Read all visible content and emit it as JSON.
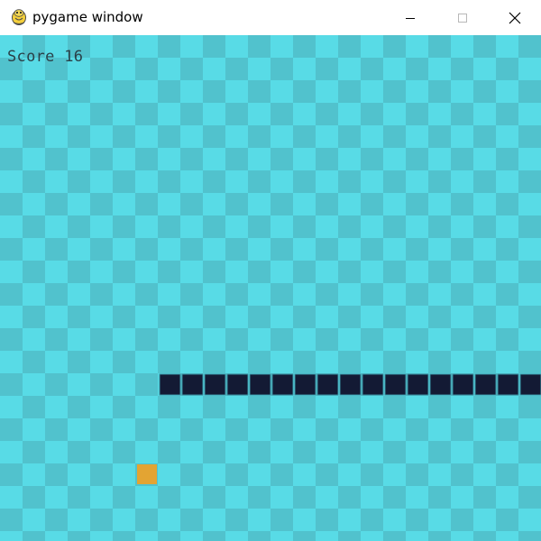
{
  "window": {
    "title": "pygame window",
    "icon": "pygame-snake-icon"
  },
  "controls": {
    "minimize_icon": "minimize-icon",
    "maximize_icon": "maximize-icon",
    "close_icon": "close-icon"
  },
  "game": {
    "score_text": "Score 16",
    "colors": {
      "checker_light": "#58dbe6",
      "checker_dark": "#51c2cd",
      "snake": "#131a34",
      "snake_outline": "#3a8fa0",
      "food": "#e3a433",
      "score_text": "#2a3f47"
    },
    "grid": {
      "columns": 24,
      "rows": 23
    },
    "snake_cells": [
      [
        7,
        15
      ],
      [
        8,
        15
      ],
      [
        9,
        15
      ],
      [
        10,
        15
      ],
      [
        11,
        15
      ],
      [
        12,
        15
      ],
      [
        13,
        15
      ],
      [
        14,
        15
      ],
      [
        15,
        15
      ],
      [
        16,
        15
      ],
      [
        17,
        15
      ],
      [
        18,
        15
      ],
      [
        19,
        15
      ],
      [
        20,
        15
      ],
      [
        21,
        15
      ],
      [
        22,
        15
      ],
      [
        23,
        15
      ]
    ],
    "food_cell": [
      6,
      19
    ]
  }
}
